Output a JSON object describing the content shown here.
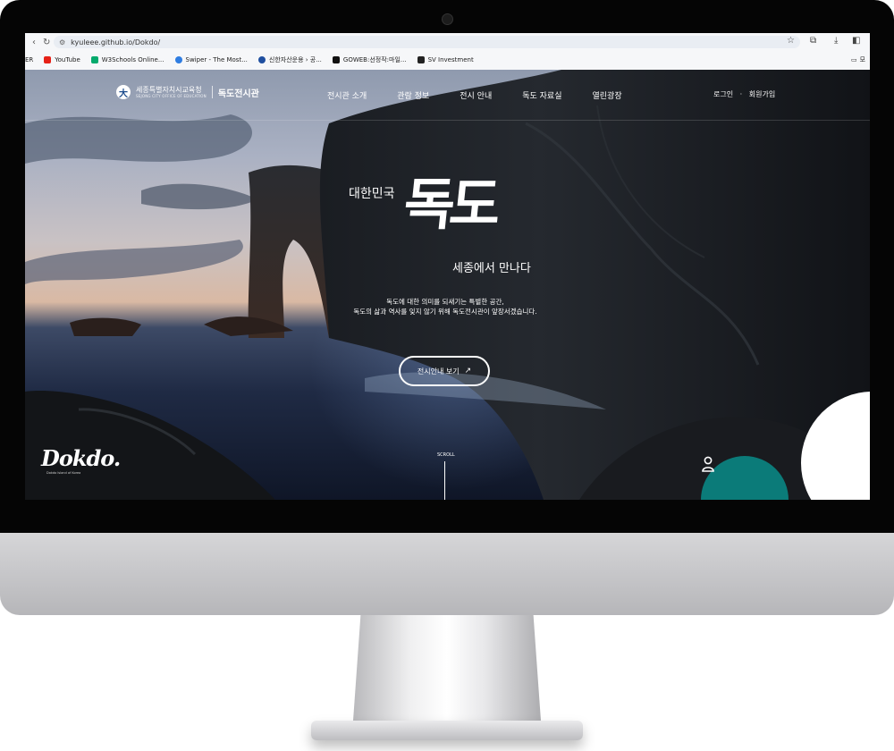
{
  "browser": {
    "url": "kyuleee.github.io/Dokdo/",
    "bookmarks": [
      {
        "label": "ER",
        "color": "#ffffff"
      },
      {
        "label": "YouTube",
        "color": "#e62117"
      },
      {
        "label": "W3Schools Online...",
        "color": "#04aa6d"
      },
      {
        "label": "Swiper - The Most...",
        "color": "#2f7de1"
      },
      {
        "label": "신한자산운용 › 공...",
        "color": "#1f4fa0"
      },
      {
        "label": "GOWEB:선정작:마일...",
        "color": "#111111"
      },
      {
        "label": "SV Investment",
        "color": "#222222"
      }
    ],
    "bookmark_folder_label": "모"
  },
  "site": {
    "org_name": "세종특별자치시교육청",
    "org_sub": "SEJONG CITY OFFICE OF EDUCATION",
    "site_name": "독도전시관",
    "menu": [
      "전시관 소개",
      "관람 정보",
      "전시 안내",
      "독도 자료실",
      "열린광장"
    ],
    "util_login": "로그인",
    "util_sep": "·",
    "util_join": "회원가입"
  },
  "hero": {
    "title_small": "대한민국",
    "title_big": "독도",
    "title_sub": "세종에서 만나다",
    "desc_line1": "독도에 대한 의미를 되새기는 특별한 공간,",
    "desc_line2": "독도의 삶과 역사를 잊지 않기 위해 독도전시관이 앞장서겠습니다.",
    "cta_label": "전시안내 보기",
    "cta_arrow": "↗",
    "logo_text": "Dokdo.",
    "logo_tag": "Dokdo Island of Korea",
    "scroll_label": "SCROLL"
  },
  "theme": {
    "fab_color": "#0b7b79",
    "icon_names": [
      "lock-icon",
      "star-icon",
      "extension-icon",
      "download-icon",
      "sidebar-icon",
      "user-icon",
      "arrow-up-right-icon",
      "folder-icon"
    ]
  }
}
